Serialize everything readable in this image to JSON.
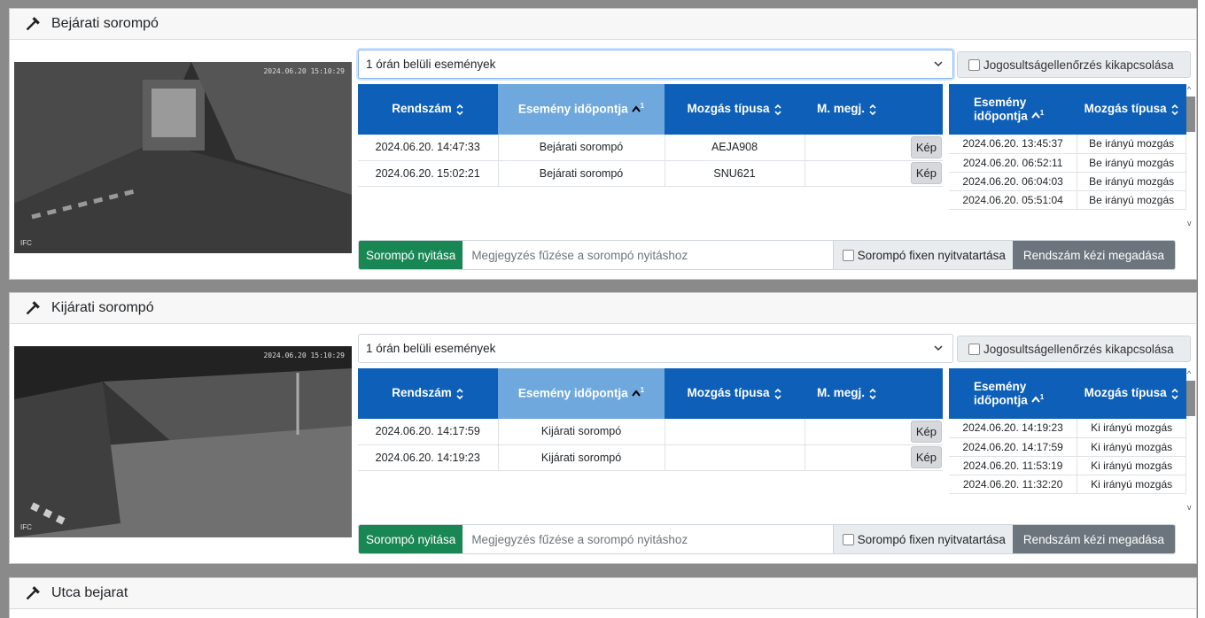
{
  "panels": [
    {
      "title": "Bejárati sorompó",
      "camera": {
        "timestamp": "2024.06.20 15:10:29",
        "label": "IFC"
      },
      "filter": "1 órán belüli események",
      "auth_disable_label": "Jogosultságellenőrzés kikapcsolása",
      "columns": [
        "Rendszám",
        "Esemény időpontja",
        "Mozgás típusa",
        "M. megj."
      ],
      "rows": [
        {
          "time": "2024.06.20. 14:47:33",
          "gate": "Bejárati sorompó",
          "plate": "AEJA908",
          "note": "",
          "btn": "Kép"
        },
        {
          "time": "2024.06.20. 15:02:21",
          "gate": "Bejárati sorompó",
          "plate": "SNU621",
          "note": "",
          "btn": "Kép"
        }
      ],
      "side_columns": [
        "Esemény időpontja",
        "Mozgás típusa"
      ],
      "side_rows": [
        {
          "time": "2024.06.20. 13:45:37",
          "type": "Be irányú mozgás"
        },
        {
          "time": "2024.06.20. 06:52:11",
          "type": "Be irányú mozgás"
        },
        {
          "time": "2024.06.20. 06:04:03",
          "type": "Be irányú mozgás"
        },
        {
          "time": "2024.06.20. 05:51:04",
          "type": "Be irányú mozgás"
        }
      ],
      "open_button": "Sorompó nyitása",
      "note_placeholder": "Megjegyzés fűzése a sorompó nyitáshoz",
      "keep_open_label": "Sorompó fixen nyitvatartása",
      "manual_button": "Rendszám kézi megadása"
    },
    {
      "title": "Kijárati sorompó",
      "camera": {
        "timestamp": "2024.06.20 15:10:29",
        "label": "IFC"
      },
      "filter": "1 órán belüli események",
      "auth_disable_label": "Jogosultságellenőrzés kikapcsolása",
      "columns": [
        "Rendszám",
        "Esemény időpontja",
        "Mozgás típusa",
        "M. megj."
      ],
      "rows": [
        {
          "time": "2024.06.20. 14:17:59",
          "gate": "Kijárati sorompó",
          "plate": "",
          "note": "",
          "btn": "Kép"
        },
        {
          "time": "2024.06.20. 14:19:23",
          "gate": "Kijárati sorompó",
          "plate": "",
          "note": "",
          "btn": "Kép"
        }
      ],
      "side_columns": [
        "Esemény időpontja",
        "Mozgás típusa"
      ],
      "side_rows": [
        {
          "time": "2024.06.20. 14:19:23",
          "type": "Ki irányú mozgás"
        },
        {
          "time": "2024.06.20. 14:17:59",
          "type": "Ki irányú mozgás"
        },
        {
          "time": "2024.06.20. 11:53:19",
          "type": "Ki irányú mozgás"
        },
        {
          "time": "2024.06.20. 11:32:20",
          "type": "Ki irányú mozgás"
        }
      ],
      "open_button": "Sorompó nyitása",
      "note_placeholder": "Megjegyzés fűzése a sorompó nyitáshoz",
      "keep_open_label": "Sorompó fixen nyitvatartása",
      "manual_button": "Rendszám kézi megadása"
    },
    {
      "title": "Utca bejarat"
    }
  ],
  "sort_index_label": "1",
  "colors": {
    "header_blue": "#0d5fb8",
    "sorted_col": "#6ea8dd",
    "open_green": "#198754",
    "manual_gray": "#6c757d"
  }
}
